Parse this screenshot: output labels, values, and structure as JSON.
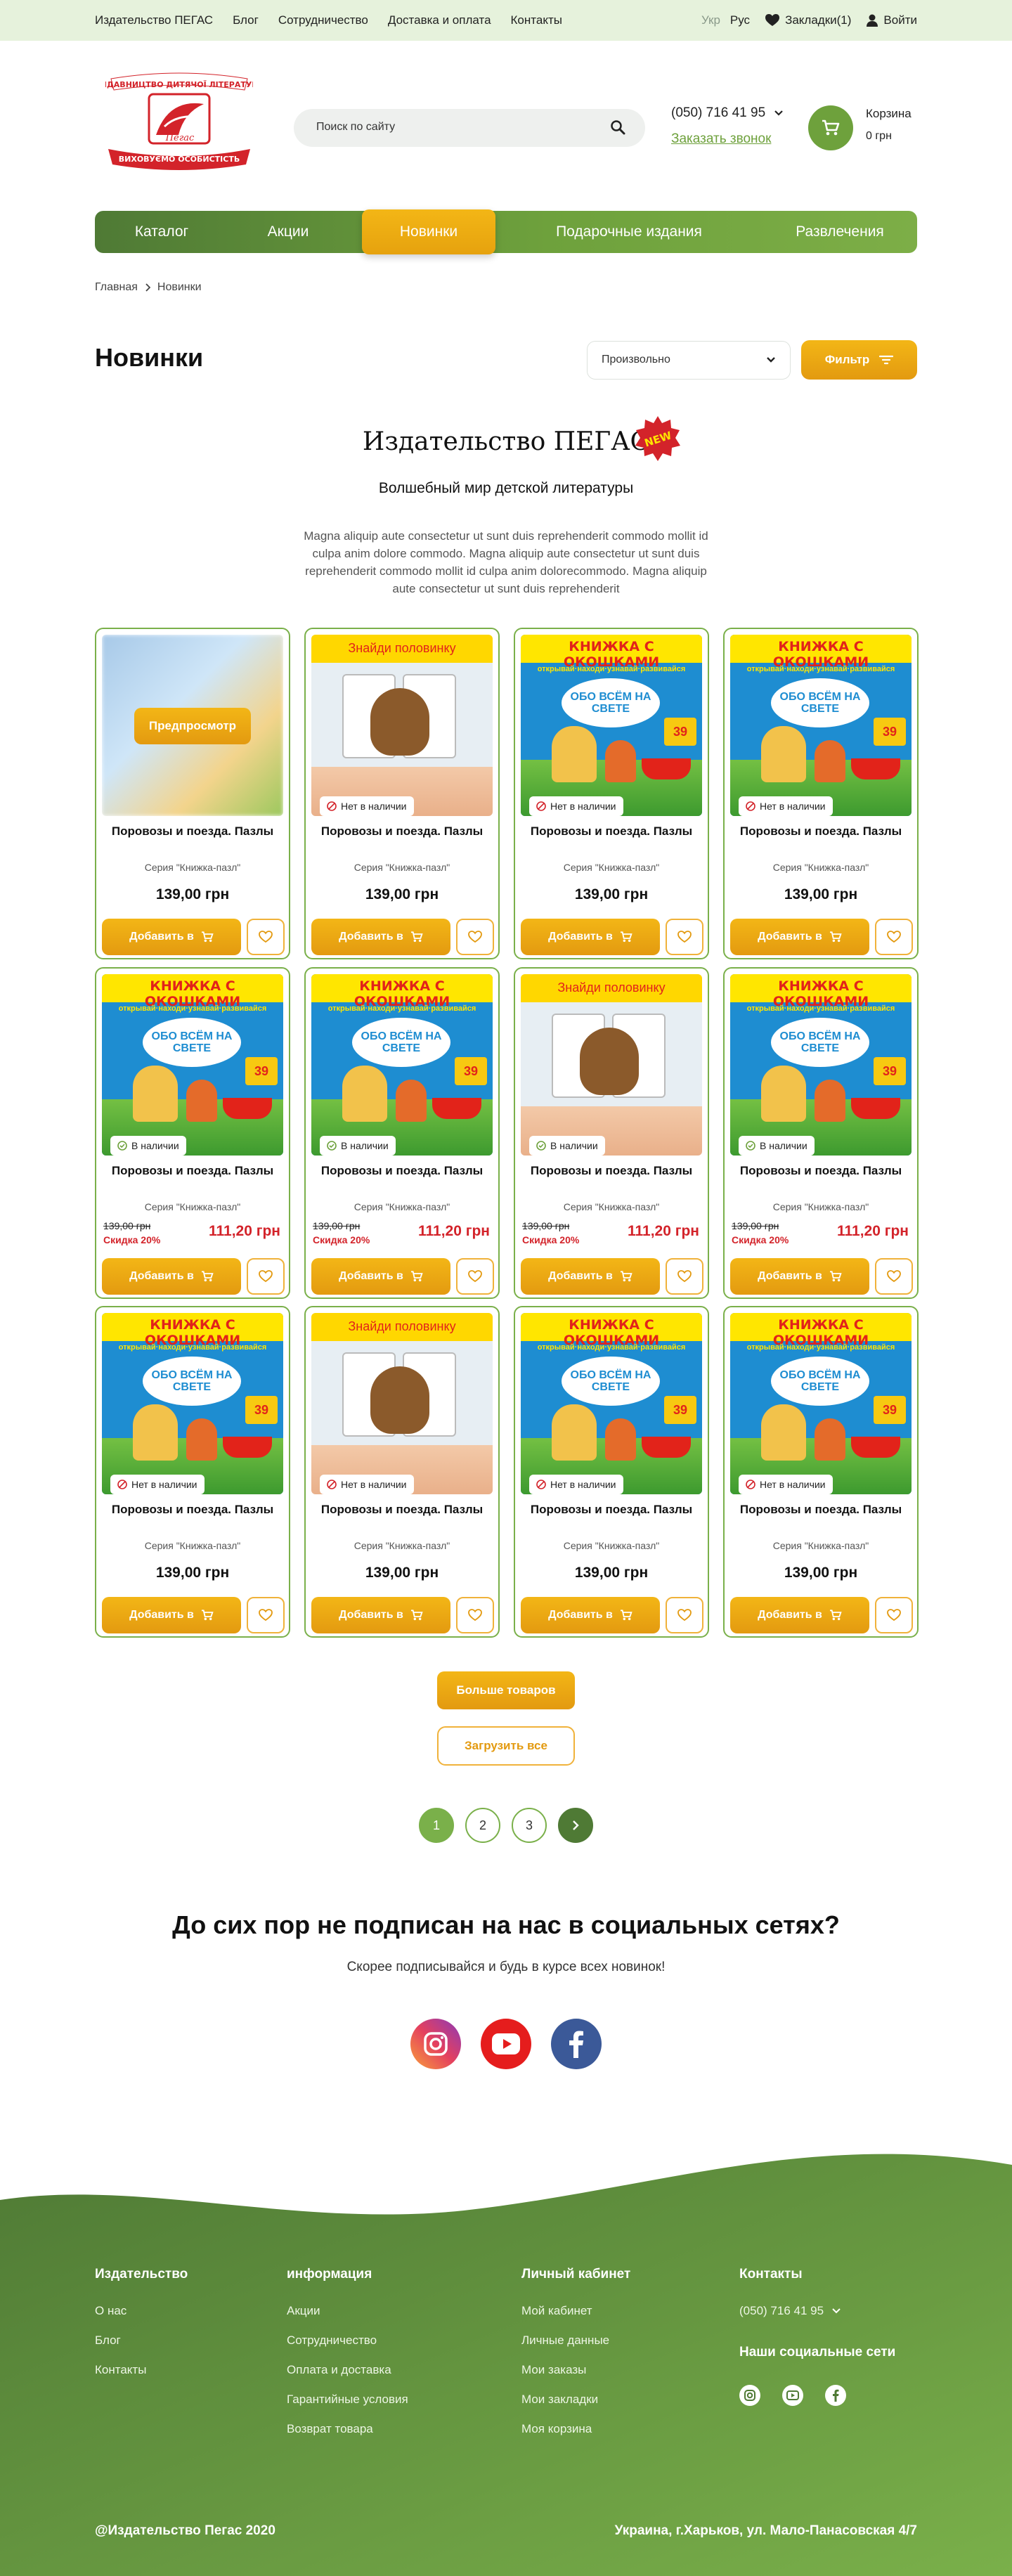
{
  "topbar": {
    "links": [
      "Издательство ПЕГАС",
      "Блог",
      "Сотрудничество",
      "Доставка и оплата",
      "Контакты"
    ],
    "lang_ukr": "Укр",
    "lang_rus": "Рус",
    "bookmarks": "Закладки(1)",
    "login": "Войти"
  },
  "logo": {
    "top_text": "ВИДАВНИЦТВО ДИТЯЧОЇ ЛІТЕРАТУРИ",
    "bottom_text": "ВИХОВУЄМО ОСОБИСТІСТЬ",
    "brand": "Пегас"
  },
  "search": {
    "placeholder": "Поиск по сайту"
  },
  "contact": {
    "phone": "(050) 716 41 95",
    "callback": "Заказать звонок"
  },
  "cart": {
    "title": "Корзина",
    "sum": "0 грн"
  },
  "nav": {
    "items": [
      "Каталог",
      "Акции",
      "Новинки",
      "Подарочные издания",
      "Развлечения"
    ],
    "active": "Новинки"
  },
  "breadcrumb": {
    "home": "Главная",
    "current": "Новинки"
  },
  "page": {
    "title": "Новинки",
    "sort_value": "Произвольно",
    "filter_label": "Фильтр"
  },
  "brand_block": {
    "title": "Издательство ПЕГАС",
    "badge": "NEW",
    "subtitle": "Волшебный мир детской литературы",
    "text": "Magna aliquip aute consectetur ut sunt duis reprehenderit commodo mollit id culpa anim dolore commodo. Magna aliquip aute consectetur ut sunt duis reprehenderit commodo mollit id culpa anim dolorecommodo. Magna aliquip aute consectetur ut sunt duis reprehenderit"
  },
  "cover_text": {
    "window_book_title": "КНИЖКА С ОКОШКАМИ",
    "window_book_sub": "открывай·находи·узнавай·развивайся",
    "window_book_bubble": "ОБО ВСЁМ НА СВЕТЕ",
    "window_book_num": "39",
    "puzzle_title": "Знайди половинку"
  },
  "products": [
    {
      "title": "Поровозы и поезда. Пазлы",
      "series": "Серия \"Книжка-пазл\"",
      "price": "139,00 грн",
      "cover": "blur",
      "preview": "Предпросмотр",
      "stock": "",
      "add": "Добавить в"
    },
    {
      "title": "Поровозы и поезда. Пазлы",
      "series": "Серия \"Книжка-пазл\"",
      "price": "139,00 грн",
      "cover": "puzzle",
      "stock": "Нет в наличии",
      "add": "Добавить в"
    },
    {
      "title": "Поровозы и поезда. Пазлы",
      "series": "Серия \"Книжка-пазл\"",
      "price": "139,00 грн",
      "cover": "window",
      "stock": "Нет в наличии",
      "add": "Добавить в"
    },
    {
      "title": "Поровозы и поезда. Пазлы",
      "series": "Серия \"Книжка-пазл\"",
      "price": "139,00 грн",
      "cover": "window",
      "stock": "Нет в наличии",
      "add": "Добавить в"
    },
    {
      "title": "Поровозы и поезда. Пазлы",
      "series": "Серия \"Книжка-пазл\"",
      "old_price": "139,00 грн",
      "discount": "Скидка 20%",
      "price": "111,20 грн",
      "cover": "window",
      "stock": "В наличии",
      "add": "Добавить в"
    },
    {
      "title": "Поровозы и поезда. Пазлы",
      "series": "Серия \"Книжка-пазл\"",
      "old_price": "139,00 грн",
      "discount": "Скидка 20%",
      "price": "111,20 грн",
      "cover": "window",
      "stock": "В наличии",
      "add": "Добавить в"
    },
    {
      "title": "Поровозы и поезда. Пазлы",
      "series": "Серия \"Книжка-пазл\"",
      "old_price": "139,00 грн",
      "discount": "Скидка 20%",
      "price": "111,20 грн",
      "cover": "puzzle",
      "stock": "В наличии",
      "add": "Добавить в"
    },
    {
      "title": "Поровозы и поезда. Пазлы",
      "series": "Серия \"Книжка-пазл\"",
      "old_price": "139,00 грн",
      "discount": "Скидка 20%",
      "price": "111,20 грн",
      "cover": "window",
      "stock": "В наличии",
      "add": "Добавить в"
    },
    {
      "title": "Поровозы и поезда. Пазлы",
      "series": "Серия \"Книжка-пазл\"",
      "price": "139,00 грн",
      "cover": "window",
      "stock": "Нет в наличии",
      "add": "Добавить в"
    },
    {
      "title": "Поровозы и поезда. Пазлы",
      "series": "Серия \"Книжка-пазл\"",
      "price": "139,00 грн",
      "cover": "puzzle",
      "stock": "Нет в наличии",
      "add": "Добавить в"
    },
    {
      "title": "Поровозы и поезда. Пазлы",
      "series": "Серия \"Книжка-пазл\"",
      "price": "139,00 грн",
      "cover": "window",
      "stock": "Нет в наличии",
      "add": "Добавить в"
    },
    {
      "title": "Поровозы и поезда. Пазлы",
      "series": "Серия \"Книжка-пазл\"",
      "price": "139,00 грн",
      "cover": "window",
      "stock": "Нет в наличии",
      "add": "Добавить в"
    }
  ],
  "load": {
    "more": "Больше товаров",
    "all": "Загрузить все"
  },
  "pagination": {
    "pages": [
      "1",
      "2",
      "3"
    ],
    "current": "1"
  },
  "social": {
    "title": "До сих пор не подписан на нас в социальных сетях?",
    "subtitle": "Скорее подписывайся и будь в курсе всех новинок!",
    "icons": [
      "instagram-icon",
      "youtube-icon",
      "facebook-icon"
    ]
  },
  "footer": {
    "col1": {
      "title": "Издательство",
      "links": [
        "О нас",
        "Блог",
        "Контакты"
      ]
    },
    "col2": {
      "title": "информация",
      "links": [
        "Акции",
        "Сотрудничество",
        "Оплата и доставка",
        "Гарантийные условия",
        "Возврат товара"
      ]
    },
    "col3": {
      "title": "Личный кабинет",
      "links": [
        "Мой кабинет",
        "Личные данные",
        "Мои заказы",
        "Мои закладки",
        "Моя корзина"
      ]
    },
    "col4": {
      "title": "Контакты",
      "phone": "(050) 716 41 95",
      "social_title": "Наши социальные сети"
    },
    "copyright": "@Издательство Пегас 2020",
    "address": "Украина,  г.Харьков, ул. Мало-Панасовская 4/7"
  },
  "colors": {
    "green": "#6ea13c",
    "dark_green": "#4f7a35",
    "orange": "#f3b616",
    "red": "#d3232a",
    "topbar_bg": "#e6f2dc"
  }
}
